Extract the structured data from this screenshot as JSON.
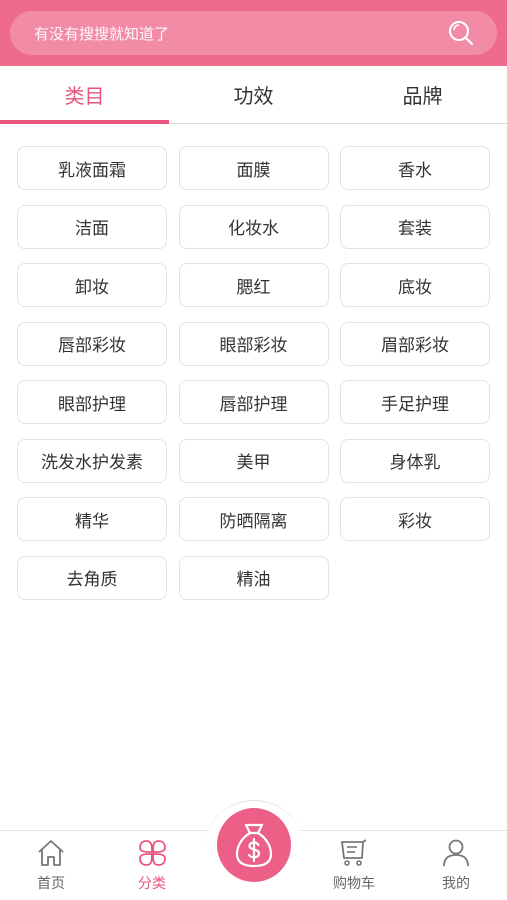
{
  "search": {
    "placeholder": "有没有搜搜就知道了",
    "icon": "search-icon"
  },
  "tabs": [
    {
      "label": "类目",
      "active": true
    },
    {
      "label": "功效",
      "active": false
    },
    {
      "label": "品牌",
      "active": false
    }
  ],
  "categories": [
    "乳液面霜",
    "面膜",
    "香水",
    "洁面",
    "化妆水",
    "套装",
    "卸妆",
    "腮红",
    "底妆",
    "唇部彩妆",
    "眼部彩妆",
    "眉部彩妆",
    "眼部护理",
    "唇部护理",
    "手足护理",
    "洗发水护发素",
    "美甲",
    "身体乳",
    "精华",
    "防晒隔离",
    "彩妆",
    "去角质",
    "精油"
  ],
  "nav": {
    "home": {
      "label": "首页",
      "icon": "home-icon"
    },
    "category": {
      "label": "分类",
      "icon": "clover-icon",
      "active": true
    },
    "center": {
      "icon": "money-bag-icon"
    },
    "cart": {
      "label": "购物车",
      "icon": "cart-icon"
    },
    "mine": {
      "label": "我的",
      "icon": "user-icon"
    }
  },
  "colors": {
    "brand": "#ef6b8e",
    "accent": "#e8557e"
  }
}
